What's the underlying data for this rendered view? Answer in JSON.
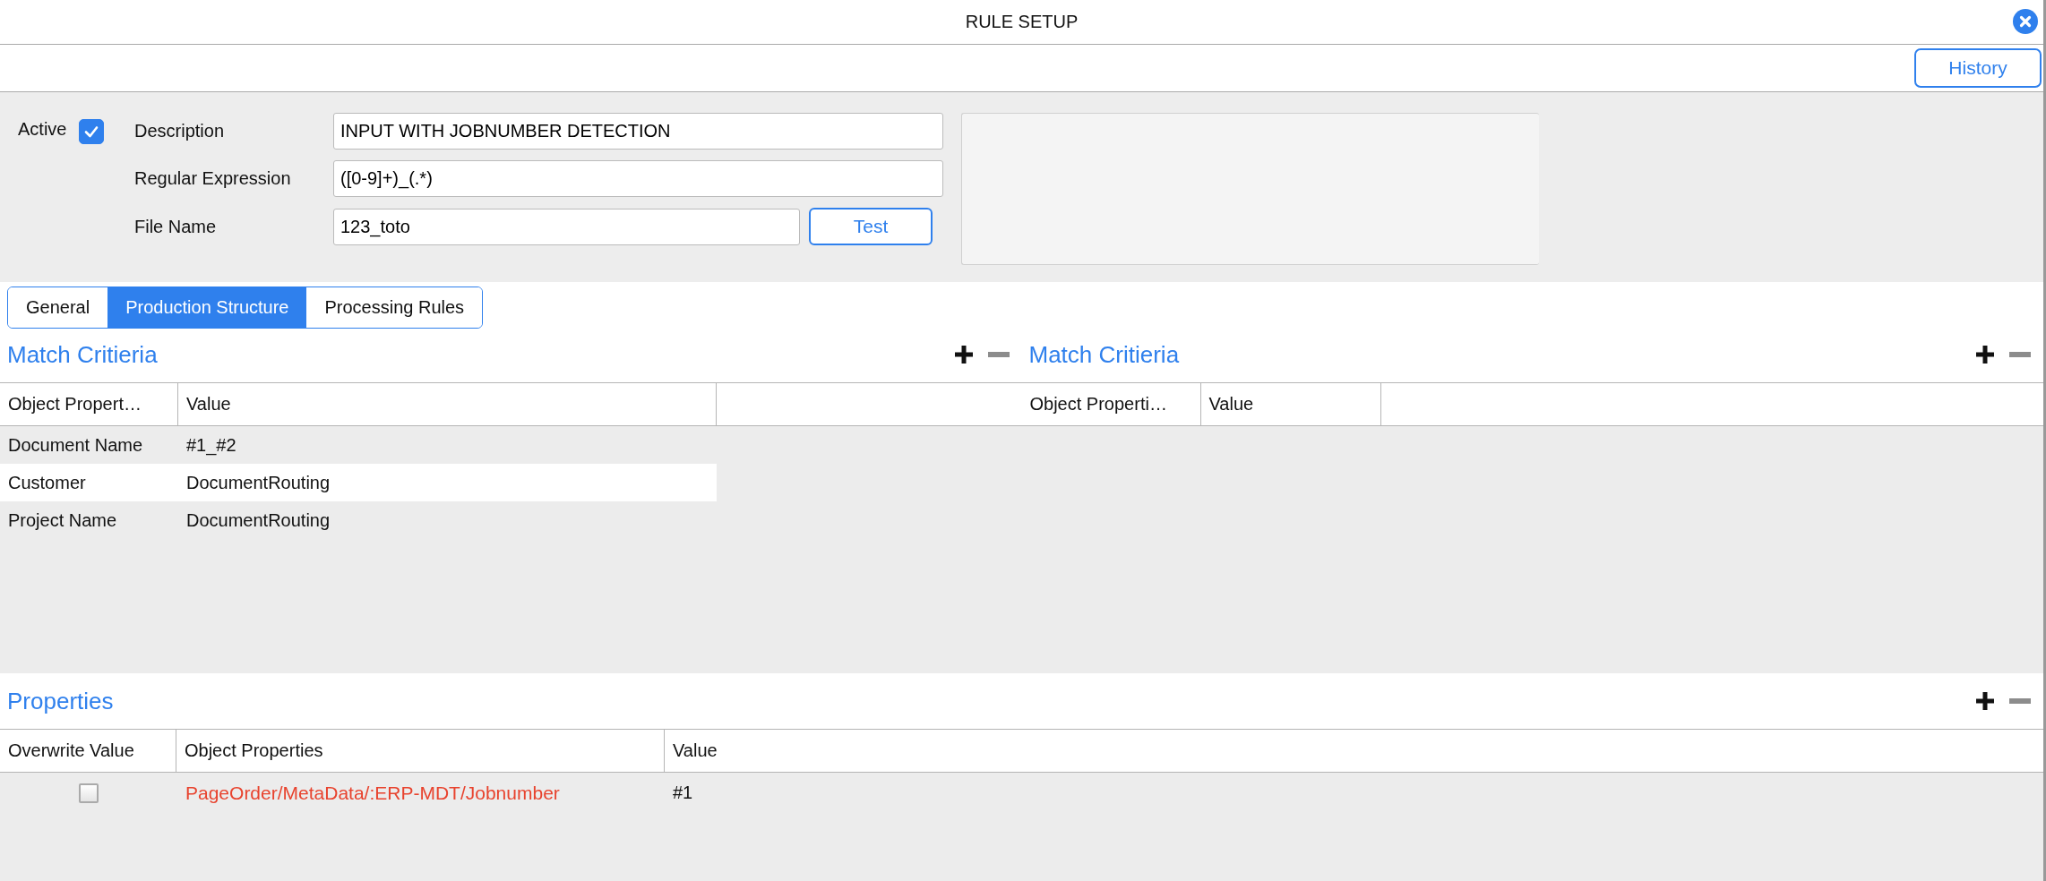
{
  "window": {
    "title": "RULE SETUP"
  },
  "toolbar": {
    "history_button": "History"
  },
  "form": {
    "active_label": "Active",
    "active": true,
    "fields": [
      {
        "label": "Description",
        "value": "INPUT WITH JOBNUMBER DETECTION"
      },
      {
        "label": "Regular Expression",
        "value": "([0-9]+)_(.*)"
      },
      {
        "label": "File Name",
        "value": "123_toto",
        "button": "Test"
      }
    ]
  },
  "tabs": [
    {
      "label": "General",
      "selected": false
    },
    {
      "label": "Production Structure",
      "selected": true
    },
    {
      "label": "Processing Rules",
      "selected": false
    }
  ],
  "match_panels": [
    {
      "title": "Match Critieria",
      "columns": [
        "Object Propert…",
        "Value"
      ],
      "rows": [
        {
          "property": "Document Name",
          "value": "#1_#2"
        },
        {
          "property": "Customer",
          "value": "DocumentRouting"
        },
        {
          "property": "Project Name",
          "value": "DocumentRouting"
        }
      ]
    },
    {
      "title": "Match Critieria",
      "columns": [
        "Object Properti…",
        "Value"
      ]
    }
  ],
  "properties": {
    "title": "Properties",
    "columns": [
      "Overwrite Value",
      "Object Properties",
      "Value"
    ],
    "rows": [
      {
        "overwrite": false,
        "object_property": "PageOrder/MetaData/:ERP-MDT/Jobnumber",
        "value": "#1",
        "error": true
      }
    ]
  }
}
